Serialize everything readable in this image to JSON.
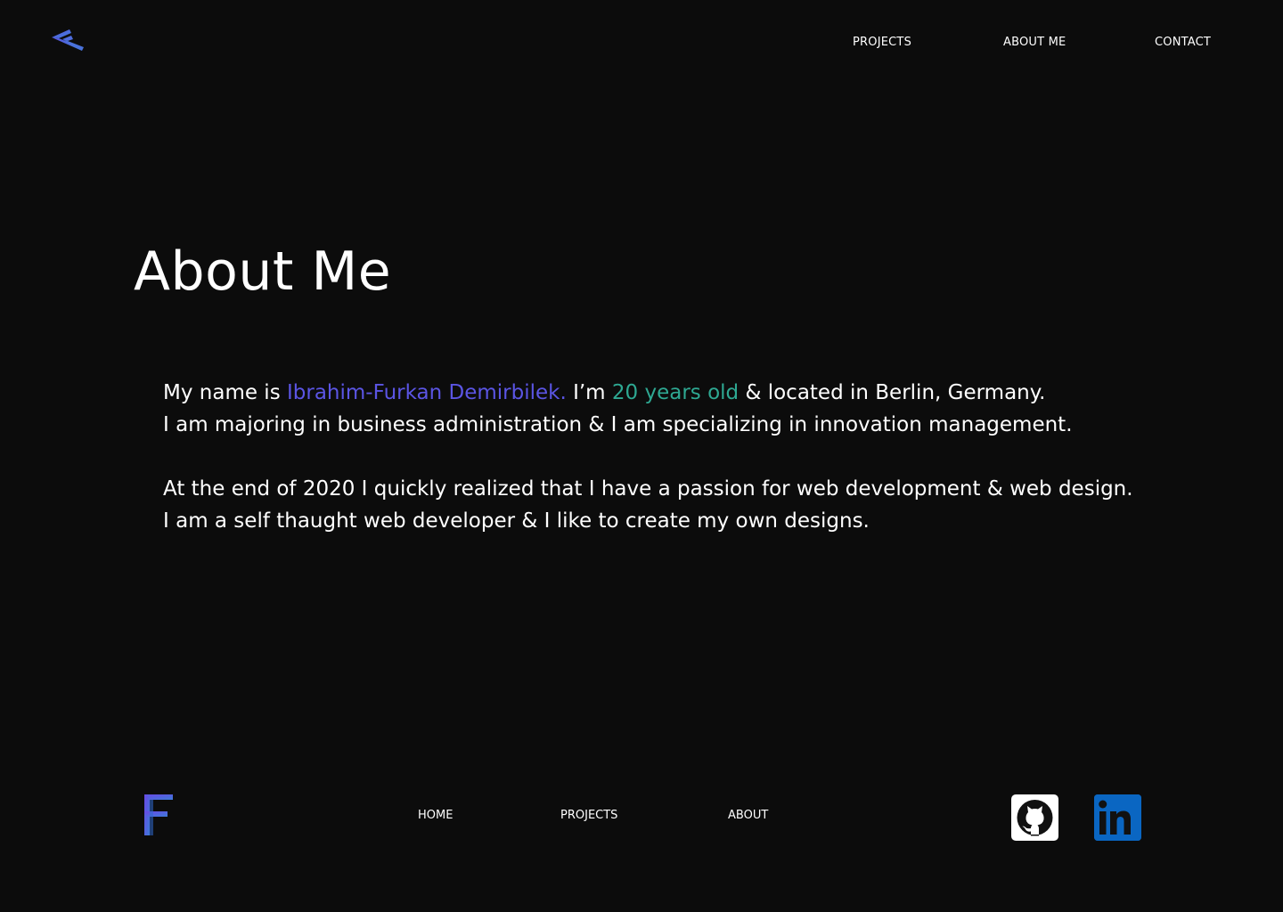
{
  "header": {
    "logo_icon": "chevron-left-logo-icon",
    "nav": [
      {
        "label": "PROJECTS"
      },
      {
        "label": "ABOUT ME"
      },
      {
        "label": "CONTACT"
      }
    ]
  },
  "main": {
    "title": "About Me",
    "bio": {
      "p1_l1_a": "My name is ",
      "name": "Ibrahim-Furkan Demirbilek.",
      "p1_l1_b": " I’m ",
      "age": "20 years old",
      "p1_l1_c": " & located in Berlin, Germany.",
      "p1_l2": "I am majoring in business administration & I am specializing in innovation management.",
      "p2_l1": "At the end of 2020 I quickly realized that I have a passion for web development & web design.",
      "p2_l2": "I am a self thaught web developer & I like to create my own designs."
    }
  },
  "footer": {
    "logo_letter": "F",
    "nav": [
      {
        "label": "HOME"
      },
      {
        "label": "PROJECTS"
      },
      {
        "label": "ABOUT"
      }
    ],
    "social": [
      {
        "icon": "github-icon"
      },
      {
        "icon": "linkedin-icon"
      }
    ]
  },
  "colors": {
    "background": "#0c0c0c",
    "text": "#ffffff",
    "accent_purple": "#5b55e4",
    "accent_teal": "#2ea892",
    "linkedin_blue": "#0a66c2"
  }
}
